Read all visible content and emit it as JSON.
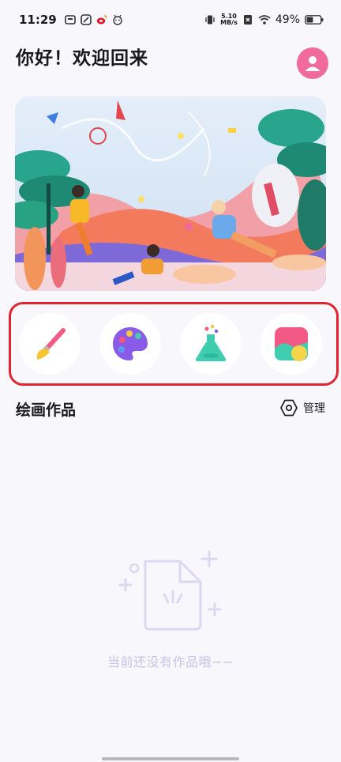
{
  "status_bar": {
    "time": "11:29",
    "net_speed_value": "5.10",
    "net_speed_unit": "MB/s",
    "battery_percent": "49%"
  },
  "header": {
    "greeting": "你好！欢迎回来"
  },
  "tools": [
    {
      "icon": "paintbrush-icon"
    },
    {
      "icon": "palette-icon"
    },
    {
      "icon": "flask-icon"
    },
    {
      "icon": "gallery-icon"
    }
  ],
  "works": {
    "title": "绘画作品",
    "manage_label": "管理",
    "empty_text": "当前还没有作品哦~~"
  },
  "colors": {
    "highlight_frame": "#e0252f",
    "avatar_bg": "#f06a9c",
    "empty_text": "#c9c3e6"
  }
}
